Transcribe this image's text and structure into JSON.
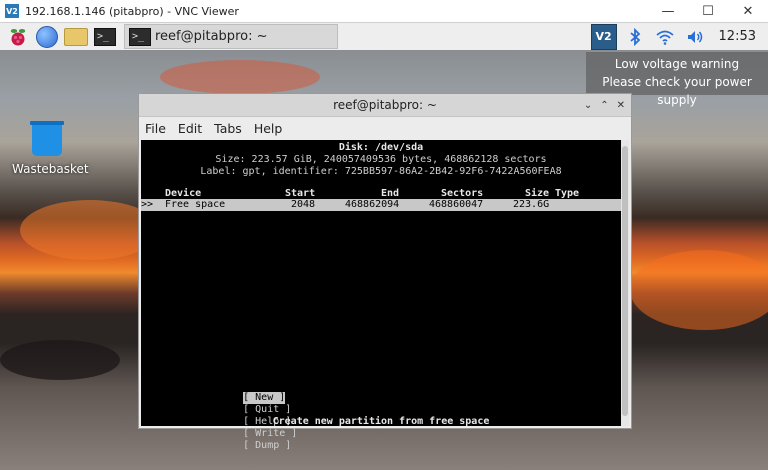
{
  "vnc": {
    "title": "192.168.1.146 (pitabpro) - VNC Viewer",
    "logo": "V2",
    "minimize": "—",
    "maximize": "☐",
    "close": "✕"
  },
  "panel": {
    "task_label": "reef@pitabpro: ~",
    "vnc_tray_label": "V2",
    "clock": "12:53",
    "icons": [
      "raspberry-icon",
      "globe-icon",
      "folder-icon",
      "terminal-icon",
      "vnc-tray-icon",
      "bluetooth-icon",
      "wifi-icon",
      "volume-icon"
    ]
  },
  "desktop": {
    "wastebasket_label": "Wastebasket"
  },
  "notification": {
    "line1": "Low voltage warning",
    "line2": "Please check your power supply"
  },
  "terminal": {
    "title": "reef@pitabpro: ~",
    "controls": [
      "⌄",
      "⌃",
      "✕"
    ],
    "menu": [
      "File",
      "Edit",
      "Tabs",
      "Help"
    ]
  },
  "cfdisk": {
    "disk": "Disk: /dev/sda",
    "size": "Size: 223.57 GiB, 240057409536 bytes, 468862128 sectors",
    "label": "Label: gpt, identifier: 725BB597-86A2-2B42-92F6-7422A560FEA8",
    "headers": {
      "device": "Device",
      "start": "Start",
      "end": "End",
      "sectors": "Sectors",
      "size": "Size",
      "type": "Type"
    },
    "row": {
      "cursor": ">>",
      "device": "Free space",
      "start": "2048",
      "end": "468862094",
      "sectors": "468860047",
      "size": "223.6G"
    },
    "actions": [
      "[ New ]",
      "[ Quit ]",
      "[ Help ]",
      "[ Write ]",
      "[ Dump ]"
    ],
    "status": "Create new partition from free space"
  }
}
